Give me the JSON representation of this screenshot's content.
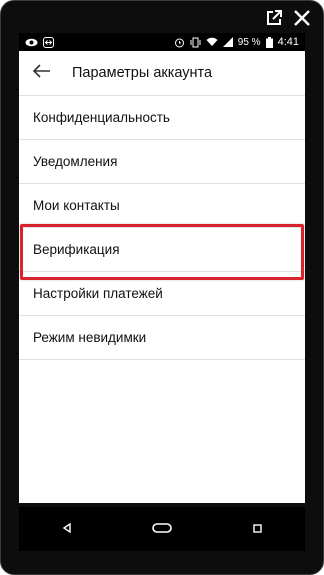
{
  "status_bar": {
    "battery_percent": "95 %",
    "time": "4:41",
    "left_icons": [
      "eye-icon",
      "teamviewer-icon"
    ],
    "right_icons": [
      "alarm-icon",
      "vibrate-icon",
      "wifi-icon",
      "signal-icon",
      "battery-icon"
    ]
  },
  "app_bar": {
    "title": "Параметры аккаунта",
    "back_icon": "arrow-left-icon"
  },
  "menu": {
    "items": [
      {
        "label": "Конфиденциальность"
      },
      {
        "label": "Уведомления"
      },
      {
        "label": "Мои контакты"
      },
      {
        "label": "Верификация"
      },
      {
        "label": "Настройки платежей"
      },
      {
        "label": "Режим невидимки"
      }
    ]
  },
  "highlight": {
    "item": "Верификация",
    "color": "#d9232d"
  },
  "nav_bar": {
    "icons": [
      "back-triangle-icon",
      "home-pill-icon",
      "recents-square-icon"
    ]
  },
  "frame_icons": [
    "open-external-icon",
    "close-icon"
  ]
}
